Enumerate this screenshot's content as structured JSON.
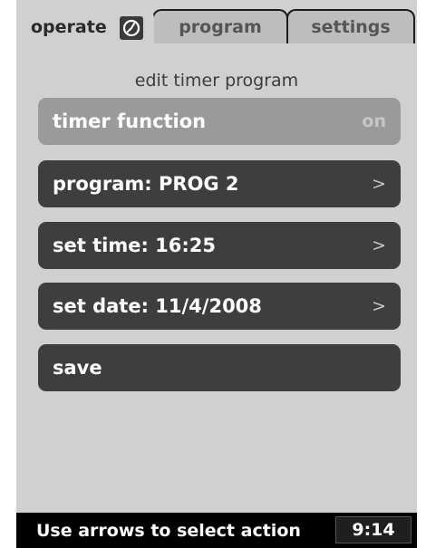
{
  "tabs": {
    "operate": "operate",
    "program": "program",
    "settings": "settings",
    "operate_icon": "timer-icon"
  },
  "heading": "edit timer program",
  "rows": [
    {
      "label": "timer function",
      "value": "on"
    },
    {
      "label": "program: PROG 2",
      "value": ">"
    },
    {
      "label": "set time: 16:25",
      "value": ">"
    },
    {
      "label": "set date: 11/4/2008",
      "value": ">"
    },
    {
      "label": "save",
      "value": ""
    }
  ],
  "status": {
    "message": "Use arrows to select action",
    "clock": "9:14"
  },
  "colors": {
    "panel": "#d0d0d0",
    "row": "#3e3e3e",
    "row_active": "#9a9a9a",
    "statusbar": "#000000"
  }
}
